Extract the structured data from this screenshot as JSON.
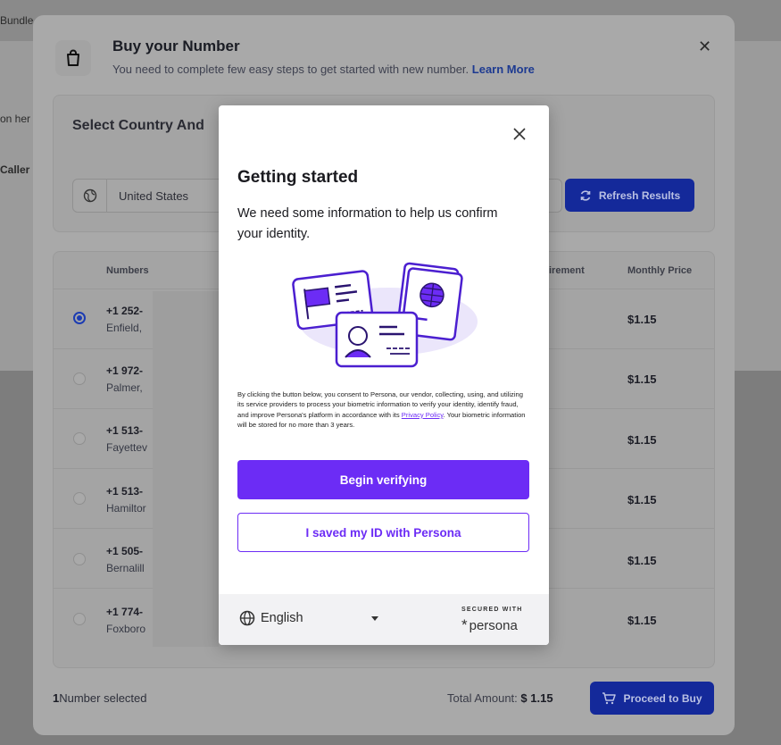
{
  "background": {
    "bundle_text": "Bundle",
    "left_text_1": "on her",
    "left_text_2": "Caller"
  },
  "buy_modal": {
    "title": "Buy your Number",
    "subtitle": "You need to complete few easy steps to get started with new number.",
    "learn_more": "Learn More",
    "section_title": "Select Country And",
    "country": "United States",
    "refresh_label": "Refresh Results",
    "table": {
      "col_numbers": "Numbers",
      "col_requirement": "irement",
      "col_price": "Monthly Price",
      "rows": [
        {
          "number": "+1 252-",
          "city": "Enfield,",
          "price": "$1.15",
          "selected": true
        },
        {
          "number": "+1 972-",
          "city": "Palmer,",
          "price": "$1.15",
          "selected": false
        },
        {
          "number": "+1 513-",
          "city": "Fayettev",
          "price": "$1.15",
          "selected": false
        },
        {
          "number": "+1 513-",
          "city": "Hamiltor",
          "price": "$1.15",
          "selected": false
        },
        {
          "number": "+1 505-",
          "city": "Bernalill",
          "price": "$1.15",
          "selected": false
        },
        {
          "number": "+1 774-",
          "city": "Foxboro",
          "price": "$1.15",
          "selected": false
        }
      ]
    },
    "selected_count": "1",
    "selected_label": "Number selected",
    "total_label": "Total Amount:",
    "total_value": "$ 1.15",
    "proceed_label": "Proceed to Buy"
  },
  "persona": {
    "title": "Getting started",
    "description": "We need some information to help us confirm your identity.",
    "consent_before": "By clicking the button below, you consent to Persona, our vendor, collecting, using, and utilizing its service providers to process your biometric information to verify your identity, identify fraud, and improve Persona's platform in accordance with its ",
    "privacy_link": "Privacy Policy",
    "consent_after": ". Your biometric information will be stored for no more than 3 years.",
    "primary_button": "Begin verifying",
    "secondary_button": "I saved my ID with Persona",
    "language": "English",
    "secured_with": "SECURED WITH",
    "brand": "persona",
    "accent_color": "#6c2cf5"
  }
}
